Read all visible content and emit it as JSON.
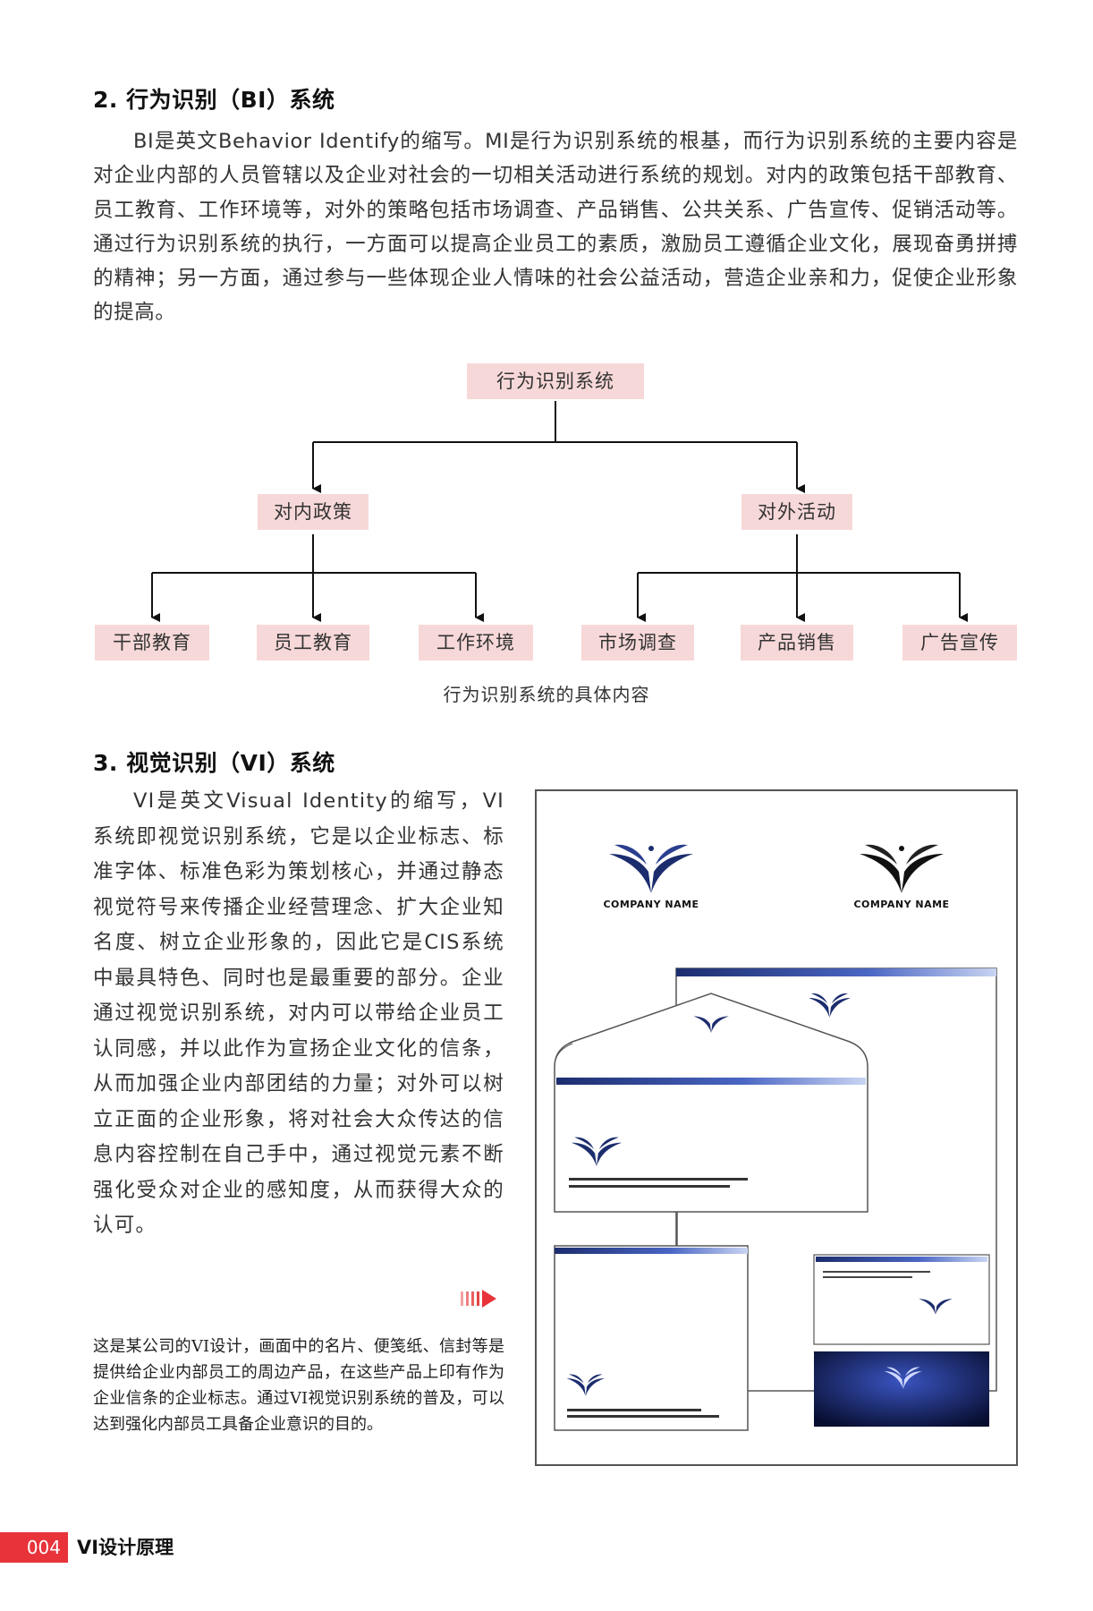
{
  "section2": {
    "heading": "2. 行为识别（BI）系统",
    "paragraph": "BI是英文Behavior Identify的缩写。MI是行为识别系统的根基，而行为识别系统的主要内容是对企业内部的人员管辖以及企业对社会的一切相关活动进行系统的规划。对内的政策包括干部教育、员工教育、工作环境等，对外的策略包括市场调查、产品销售、公共关系、广告宣传、促销活动等。通过行为识别系统的执行，一方面可以提高企业员工的素质，激励员工遵循企业文化，展现奋勇拼搏的精神；另一方面，通过参与一些体现企业人情味的社会公益活动，营造企业亲和力，促使企业形象的提高。"
  },
  "diagram": {
    "root": "行为识别系统",
    "internal": {
      "label": "对内政策",
      "children": [
        "干部教育",
        "员工教育",
        "工作环境"
      ]
    },
    "external": {
      "label": "对外活动",
      "children": [
        "市场调查",
        "产品销售",
        "广告宣传"
      ]
    },
    "caption": "行为识别系统的具体内容",
    "node_color": "#f7d8d8"
  },
  "section3": {
    "heading": "3. 视觉识别（VI）系统",
    "paragraph": "VI是英文Visual Identity的缩写，VI系统即视觉识别系统，它是以企业标志、标准字体、标准色彩为策划核心，并通过静态视觉符号来传播企业经营理念、扩大企业知名度、树立企业形象的，因此它是CIS系统中最具特色、同时也是最重要的部分。企业通过视觉识别系统，对内可以带给企业员工认同感，并以此作为宣扬企业文化的信条，从而加强企业内部团结的力量；对外可以树立正面的企业形象，将对社会大众传达的信息内容控制在自己手中，通过视觉元素不断强化受众对企业的感知度，从而获得大众的认可。",
    "figure_caption": "这是某公司的VI设计，画面中的名片、便笺纸、信封等是提供给企业内部员工的周边产品，在这些产品上印有作为企业信条的企业标志。通过VI视觉识别系统的普及，可以达到强化内部员工具备企业意识的目的。",
    "figure": {
      "logo_text": "COMPANY NAME",
      "accent_color": "#1c2d6e"
    }
  },
  "footer": {
    "page_number": "004",
    "book_title": "VI设计原理",
    "accent_color": "#e8333a"
  }
}
